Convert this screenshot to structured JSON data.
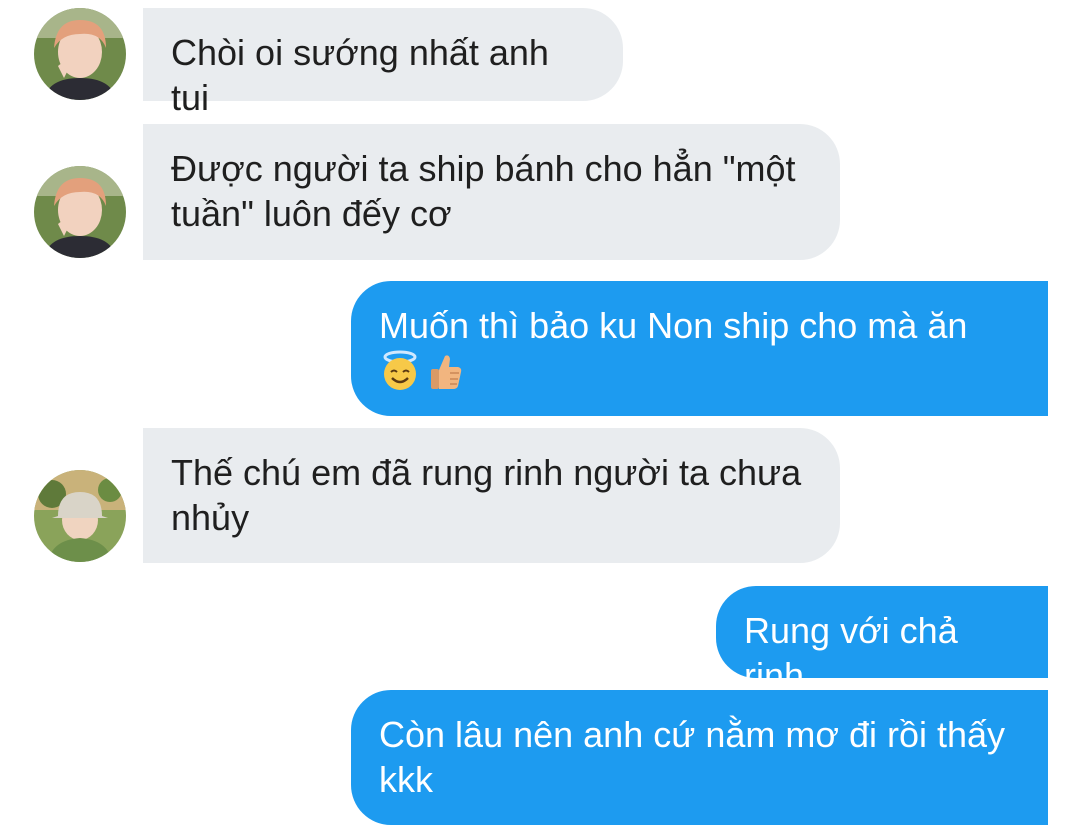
{
  "messages": [
    {
      "sender": "other",
      "text": "Chòi oi sướng nhất anh tui"
    },
    {
      "sender": "other",
      "text": "Được người ta ship bánh cho hẳn \"một tuần\" luôn đếy cơ"
    },
    {
      "sender": "me",
      "text": "Muốn thì bảo ku Non ship cho mà ăn",
      "emojis": [
        "smiling-face-with-halo-icon",
        "thumbs-up-icon"
      ]
    },
    {
      "sender": "other",
      "text": "Thế chú em đã rung rinh người ta chưa nhủy"
    },
    {
      "sender": "me",
      "text": "Rung với chả rinh"
    },
    {
      "sender": "me",
      "text": "Còn lâu nên anh cứ nằm mơ đi rồi thấy kkk"
    }
  ],
  "colors": {
    "incoming_bubble": "#e9ecef",
    "outgoing_bubble": "#1d9bf0",
    "incoming_text": "#1f1f1f",
    "outgoing_text": "#ffffff"
  }
}
